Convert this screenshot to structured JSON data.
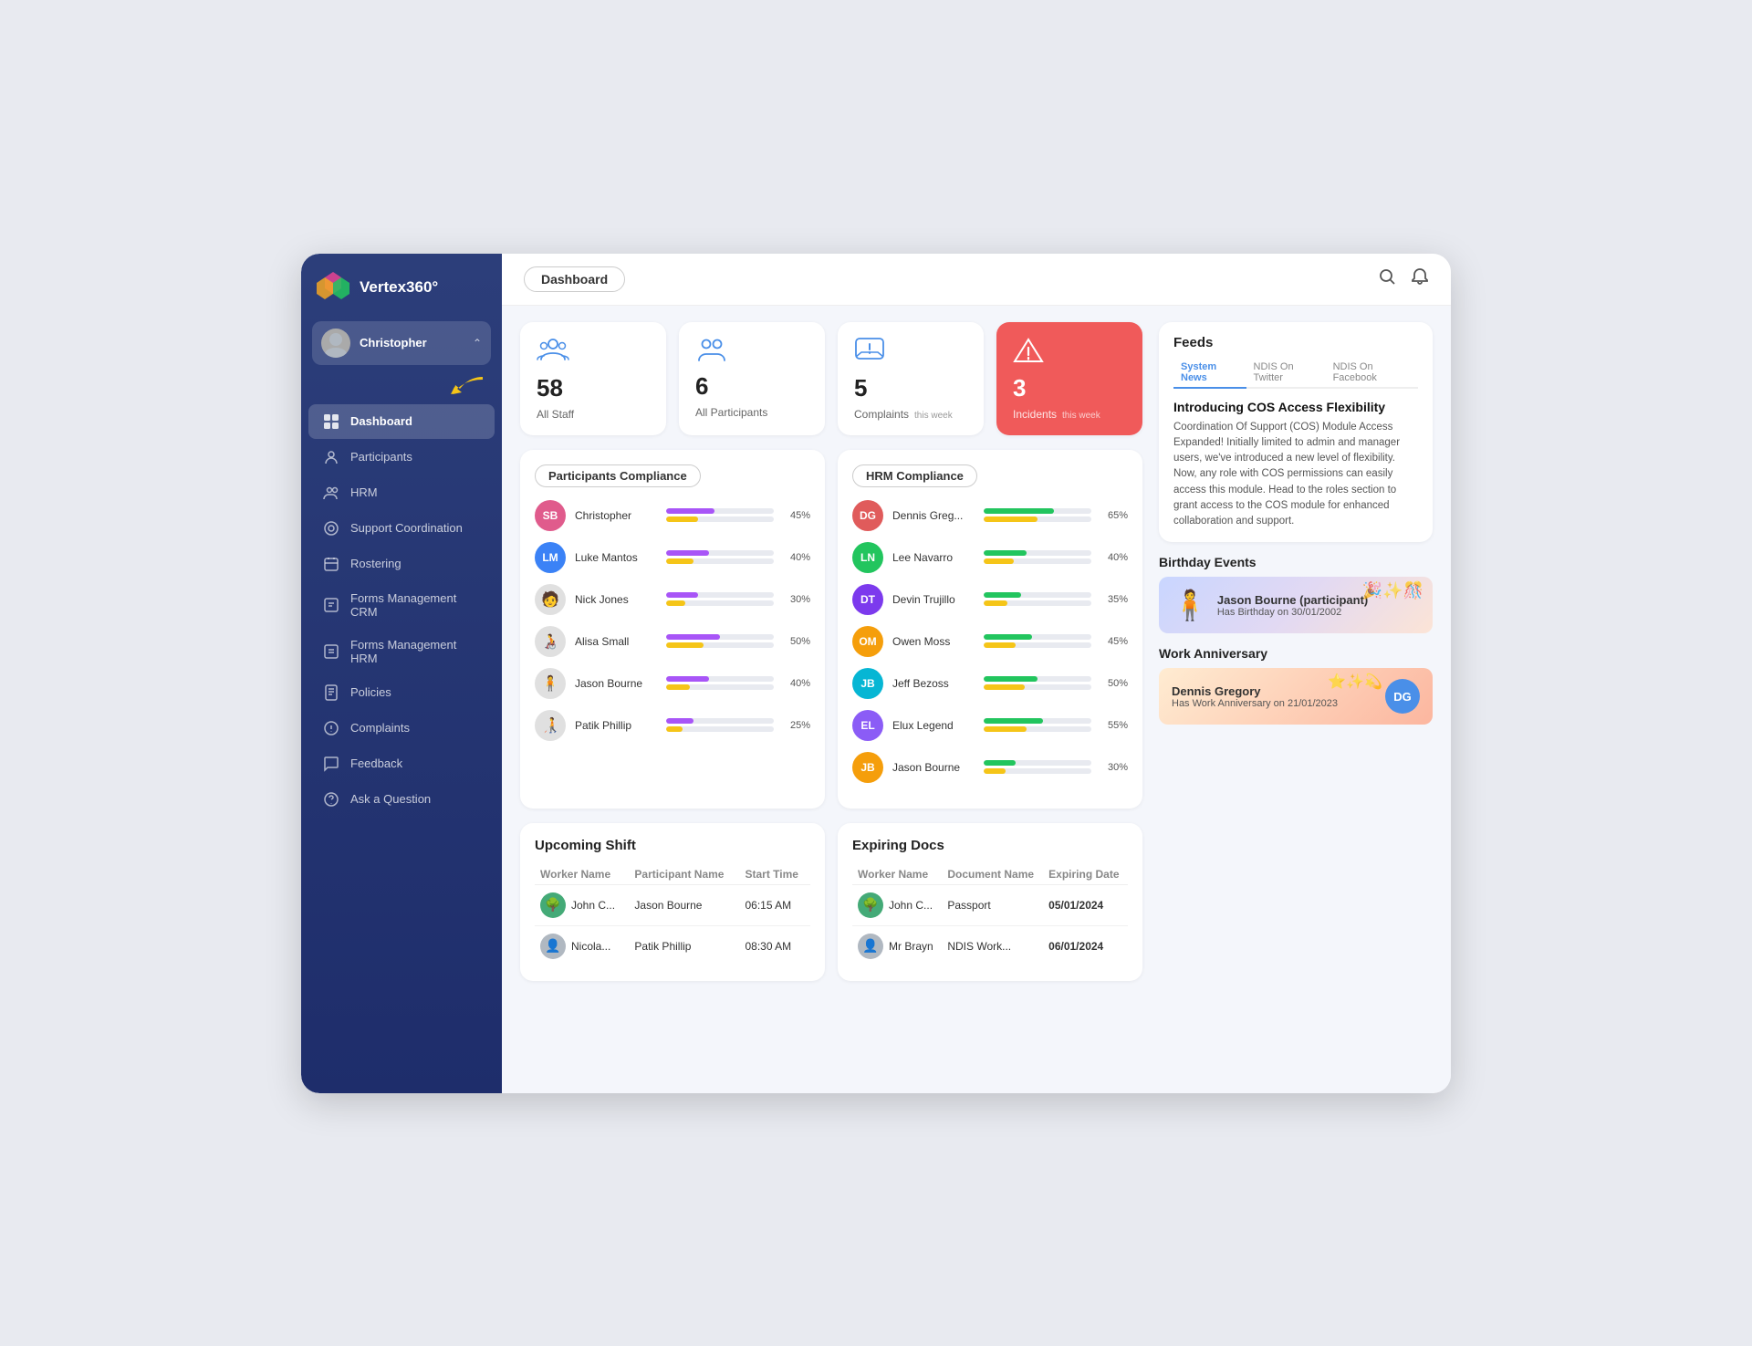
{
  "app": {
    "name": "Vertex360°",
    "page_title": "Dashboard"
  },
  "sidebar": {
    "user": {
      "name": "Christopher"
    },
    "nav_items": [
      {
        "id": "dashboard",
        "label": "Dashboard",
        "active": true
      },
      {
        "id": "participants",
        "label": "Participants",
        "active": false
      },
      {
        "id": "hrm",
        "label": "HRM",
        "active": false
      },
      {
        "id": "support-coordination",
        "label": "Support Coordination",
        "active": false
      },
      {
        "id": "rostering",
        "label": "Rostering",
        "active": false
      },
      {
        "id": "forms-crm",
        "label": "Forms Management CRM",
        "active": false
      },
      {
        "id": "forms-hrm",
        "label": "Forms Management HRM",
        "active": false
      },
      {
        "id": "policies",
        "label": "Policies",
        "active": false
      },
      {
        "id": "complaints",
        "label": "Complaints",
        "active": false
      },
      {
        "id": "feedback",
        "label": "Feedback",
        "active": false
      },
      {
        "id": "ask-question",
        "label": "Ask a Question",
        "active": false
      }
    ]
  },
  "stats": [
    {
      "id": "staff",
      "number": "58",
      "label": "All Staff",
      "sublabel": "",
      "red": false
    },
    {
      "id": "participants",
      "number": "6",
      "label": "All Participants",
      "sublabel": "",
      "red": false
    },
    {
      "id": "complaints",
      "number": "5",
      "label": "Complaints",
      "sublabel": "this week",
      "red": false
    },
    {
      "id": "incidents",
      "number": "3",
      "label": "Incidents",
      "sublabel": "this week",
      "red": true
    }
  ],
  "participants_compliance": {
    "title": "Participants Compliance",
    "items": [
      {
        "name": "Christopher",
        "initials": "SB",
        "color": "#e05b8c",
        "pct": 45
      },
      {
        "name": "Luke Mantos",
        "initials": "LM",
        "color": "#3b82f6",
        "pct": 40
      },
      {
        "name": "Nick Jones",
        "initials": null,
        "color": "#aaa",
        "pct": 30
      },
      {
        "name": "Alisa Small",
        "initials": null,
        "color": "#aaa",
        "pct": 50
      },
      {
        "name": "Jason Bourne",
        "initials": null,
        "color": "#aaa",
        "pct": 40
      },
      {
        "name": "Patik Phillip",
        "initials": null,
        "color": "#aaa",
        "pct": 25
      }
    ]
  },
  "hrm_compliance": {
    "title": "HRM Compliance",
    "items": [
      {
        "name": "Dennis Greg...",
        "initials": "DG",
        "color": "#e05b5b",
        "pct": 65
      },
      {
        "name": "Lee Navarro",
        "initials": "LN",
        "color": "#22c55e",
        "pct": 40
      },
      {
        "name": "Devin Trujillo",
        "initials": "DT",
        "color": "#7c3aed",
        "pct": 35
      },
      {
        "name": "Owen Moss",
        "initials": "OM",
        "color": "#f59e0b",
        "pct": 45
      },
      {
        "name": "Jeff Bezoss",
        "initials": "JB",
        "color": "#06b6d4",
        "pct": 50
      },
      {
        "name": "Elux Legend",
        "initials": "EL",
        "color": "#8b5cf6",
        "pct": 55
      },
      {
        "name": "Jason Bourne",
        "initials": "JB",
        "color": "#f59e0b",
        "pct": 30
      }
    ]
  },
  "upcoming_shift": {
    "title": "Upcoming Shift",
    "columns": [
      "Worker Name",
      "Participant Name",
      "Start Time"
    ],
    "rows": [
      {
        "worker": "John C...",
        "participant": "Jason Bourne",
        "time": "06:15 AM"
      },
      {
        "worker": "Nicola...",
        "participant": "Patik Phillip",
        "time": "08:30 AM"
      }
    ]
  },
  "expiring_docs": {
    "title": "Expiring Docs",
    "columns": [
      "Worker Name",
      "Document Name",
      "Expiring Date"
    ],
    "rows": [
      {
        "worker": "John C...",
        "document": "Passport",
        "date": "05/01/2024"
      },
      {
        "worker": "Mr Brayn",
        "document": "NDIS Work...",
        "date": "06/01/2024"
      }
    ]
  },
  "feeds": {
    "title": "Feeds",
    "tabs": [
      "System News",
      "NDIS On Twitter",
      "NDIS On Facebook"
    ],
    "active_tab": "System News",
    "article_title": "Introducing COS Access Flexibility",
    "article_text": "Coordination Of Support (COS) Module Access Expanded! Initially limited to admin and manager users, we've introduced a new level of flexibility. Now, any role with COS permissions can easily access this module. Head to the roles section to grant access to the COS module for enhanced collaboration and support."
  },
  "birthday_events": {
    "section_title": "Birthday Events",
    "name": "Jason Bourne (participant)",
    "date": "Has Birthday on 30/01/2002"
  },
  "work_anniversary": {
    "section_title": "Work Anniversary",
    "name": "Dennis Gregory",
    "date": "Has Work Anniversary on 21/01/2023",
    "initials": "DG"
  }
}
